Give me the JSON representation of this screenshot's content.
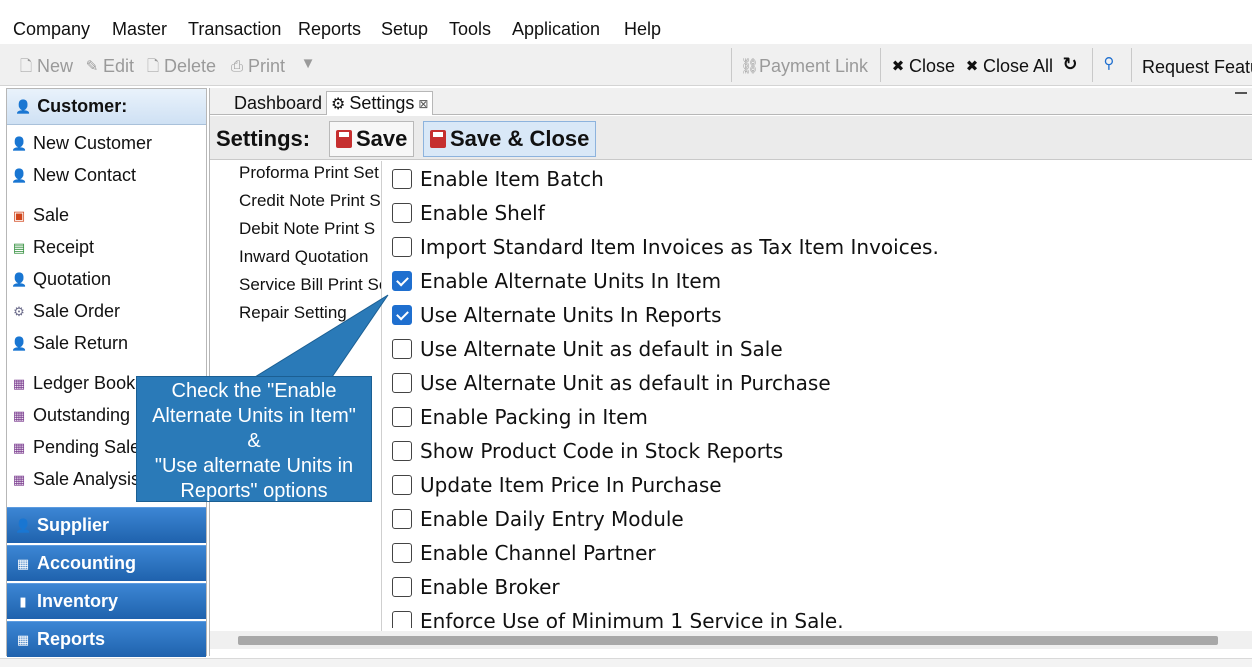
{
  "menu": [
    "Company",
    "Master",
    "Transaction",
    "Reports",
    "Setup",
    "Tools",
    "Application",
    "Help"
  ],
  "toolbar": {
    "new": "New",
    "edit": "Edit",
    "delete": "Delete",
    "print": "Print",
    "payment_link": "Payment Link",
    "close": "Close",
    "close_all": "Close All",
    "request_feature": "Request Featu"
  },
  "sidebar": {
    "header": "Customer:",
    "items": [
      "New Customer",
      "New Contact",
      "Sale",
      "Receipt",
      "Quotation",
      "Sale Order",
      "Sale Return",
      "Ledger Book",
      "Outstanding",
      "Pending Sale",
      "Sale Analysis"
    ],
    "groups": [
      "Supplier",
      "Accounting",
      "Inventory",
      "Reports"
    ]
  },
  "tabs": {
    "dashboard": "Dashboard",
    "settings": "Settings"
  },
  "settings_bar": {
    "title": "Settings:",
    "save": "Save",
    "save_close": "Save & Close"
  },
  "settings_list": [
    "Proforma Print Set",
    "Credit Note Print S",
    "Debit Note Print S",
    "Inward Quotation",
    "Service Bill Print Se",
    "Repair Setting"
  ],
  "options": [
    {
      "label": "Enable Item Batch",
      "checked": false
    },
    {
      "label": "Enable Shelf",
      "checked": false
    },
    {
      "label": "Import Standard Item Invoices as Tax Item Invoices.",
      "checked": false
    },
    {
      "label": "Enable Alternate Units In Item",
      "checked": true
    },
    {
      "label": "Use Alternate Units In Reports",
      "checked": true
    },
    {
      "label": "Use Alternate Unit as default in Sale",
      "checked": false
    },
    {
      "label": "Use Alternate Unit as default in Purchase",
      "checked": false
    },
    {
      "label": "Enable Packing in Item",
      "checked": false
    },
    {
      "label": "Show Product Code in Stock Reports",
      "checked": false
    },
    {
      "label": "Update Item Price In Purchase",
      "checked": false
    },
    {
      "label": "Enable Daily Entry Module",
      "checked": false
    },
    {
      "label": "Enable Channel Partner",
      "checked": false
    },
    {
      "label": "Enable Broker",
      "checked": false
    },
    {
      "label": "Enforce Use of Minimum 1 Service in Sale.",
      "checked": false
    }
  ],
  "callout": {
    "line1": "Check the \"Enable",
    "line2": "Alternate Units in Item\"",
    "line3": "&",
    "line4": "\"Use alternate Units in",
    "line5": "Reports\" options"
  },
  "colors": {
    "accent": "#1f6fcf",
    "group_blue": "#2a6fc0",
    "callout": "#2a7ab8"
  }
}
